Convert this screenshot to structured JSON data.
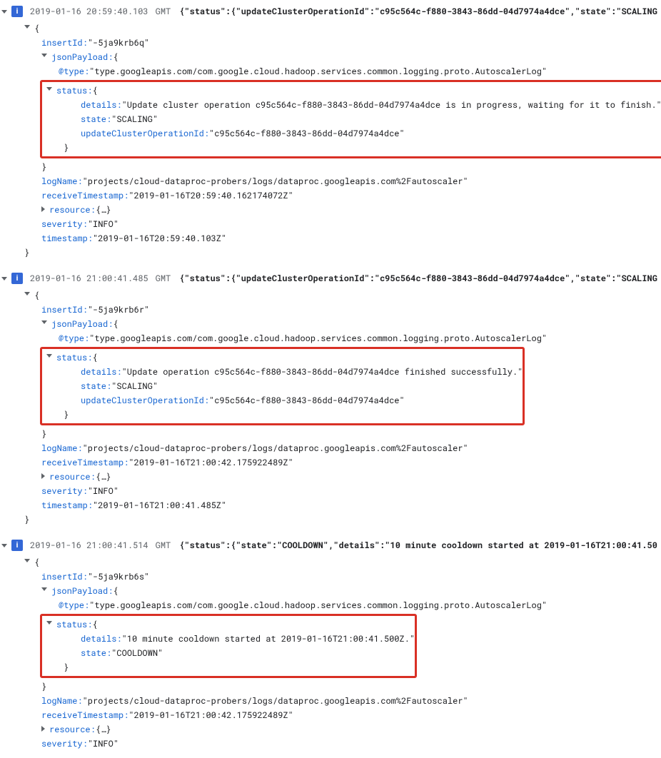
{
  "entries": [
    {
      "timestamp": "2019-01-16 20:59:40.103",
      "tz": "GMT",
      "summary": "{\"status\":{\"updateClusterOperationId\":\"c95c564c-f880-3843-86dd-04d7974a4dce\",\"state\":\"SCALING",
      "insertId": "\"-5ja9krb6q\"",
      "atType": "\"type.googleapis.com/com.google.cloud.hadoop.services.common.logging.proto.AutoscalerLog\"",
      "status": {
        "details": "\"Update cluster operation c95c564c-f880-3843-86dd-04d7974a4dce is in progress, waiting for it to finish.\"",
        "state": "\"SCALING\"",
        "updateClusterOperationId": "\"c95c564c-f880-3843-86dd-04d7974a4dce\""
      },
      "logName": "\"projects/cloud-dataproc-probers/logs/dataproc.googleapis.com%2Fautoscaler\"",
      "receiveTimestamp": "\"2019-01-16T20:59:40.162174072Z\"",
      "severity": "\"INFO\"",
      "timestampField": "\"2019-01-16T20:59:40.103Z\"",
      "boxClass": "w1"
    },
    {
      "timestamp": "2019-01-16 21:00:41.485",
      "tz": "GMT",
      "summary": "{\"status\":{\"updateClusterOperationId\":\"c95c564c-f880-3843-86dd-04d7974a4dce\",\"state\":\"SCALING",
      "insertId": "\"-5ja9krb6r\"",
      "atType": "\"type.googleapis.com/com.google.cloud.hadoop.services.common.logging.proto.AutoscalerLog\"",
      "status": {
        "details": "\"Update operation c95c564c-f880-3843-86dd-04d7974a4dce finished successfully.\"",
        "state": "\"SCALING\"",
        "updateClusterOperationId": "\"c95c564c-f880-3843-86dd-04d7974a4dce\""
      },
      "logName": "\"projects/cloud-dataproc-probers/logs/dataproc.googleapis.com%2Fautoscaler\"",
      "receiveTimestamp": "\"2019-01-16T21:00:42.175922489Z\"",
      "severity": "\"INFO\"",
      "timestampField": "\"2019-01-16T21:00:41.485Z\"",
      "boxClass": "w2"
    },
    {
      "timestamp": "2019-01-16 21:00:41.514",
      "tz": "GMT",
      "summary": "{\"status\":{\"state\":\"COOLDOWN\",\"details\":\"10 minute cooldown started at 2019-01-16T21:00:41.50",
      "insertId": "\"-5ja9krb6s\"",
      "atType": "\"type.googleapis.com/com.google.cloud.hadoop.services.common.logging.proto.AutoscalerLog\"",
      "status": {
        "details": "\"10 minute cooldown started at 2019-01-16T21:00:41.500Z.\"",
        "state": "\"COOLDOWN\""
      },
      "logName": "\"projects/cloud-dataproc-probers/logs/dataproc.googleapis.com%2Fautoscaler\"",
      "receiveTimestamp": "\"2019-01-16T21:00:42.175922489Z\"",
      "severity": "\"INFO\"",
      "timestampField": "",
      "boxClass": "w3"
    }
  ],
  "labels": {
    "sev": "i",
    "insertId": "insertId:",
    "jsonPayload": "jsonPayload:",
    "atType": "@type:",
    "status": "status:",
    "details": "details:",
    "state": "state:",
    "updateClusterOperationId": "updateClusterOperationId:",
    "logName": "logName:",
    "receiveTimestamp": "receiveTimestamp:",
    "resource": "resource:",
    "resourceVal": "{…}",
    "severity": "severity:",
    "timestamp": "timestamp:",
    "openBrace": "{",
    "closeBrace": "}"
  }
}
